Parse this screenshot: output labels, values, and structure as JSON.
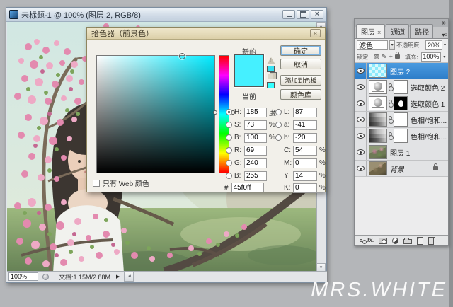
{
  "doc_window": {
    "title": "未标题-1 @ 100% (图层 2, RGB/8)"
  },
  "status_bar": {
    "zoom": "100%",
    "doc_info": "文档:1.15M/2.88M"
  },
  "picker": {
    "title": "拾色器（前景色）",
    "new_label": "新的",
    "current_label": "当前",
    "buttons": {
      "ok": "确定",
      "cancel": "取消",
      "add_to_swatches": "添加到色板",
      "color_libraries": "颜色库"
    },
    "web_only_label": "只有 Web 颜色",
    "hex_label": "#",
    "hex_value": "45f0ff",
    "selected_color_hex": "#45f0ff",
    "hue_degrees": 185,
    "left_fields": [
      {
        "label": "H:",
        "value": "185",
        "unit": "度"
      },
      {
        "label": "S:",
        "value": "73",
        "unit": "%"
      },
      {
        "label": "B:",
        "value": "100",
        "unit": "%"
      },
      {
        "label": "R:",
        "value": "69",
        "unit": ""
      },
      {
        "label": "G:",
        "value": "240",
        "unit": ""
      },
      {
        "label": "B:",
        "value": "255",
        "unit": ""
      }
    ],
    "right_fields": [
      {
        "label": "L:",
        "value": "87",
        "unit": ""
      },
      {
        "label": "a:",
        "value": "-41",
        "unit": ""
      },
      {
        "label": "b:",
        "value": "-20",
        "unit": ""
      },
      {
        "label": "C:",
        "value": "54",
        "unit": "%"
      },
      {
        "label": "M:",
        "value": "0",
        "unit": "%"
      },
      {
        "label": "Y:",
        "value": "14",
        "unit": "%"
      },
      {
        "label": "K:",
        "value": "0",
        "unit": "%"
      }
    ]
  },
  "layers_panel": {
    "tabs": [
      {
        "label": "图层"
      },
      {
        "label": "通道"
      },
      {
        "label": "路径"
      }
    ],
    "active_tab_close": "×",
    "blend_mode": "滤色",
    "opacity_label": "不透明度:",
    "opacity_value": "20%",
    "lock_label": "锁定:",
    "fill_label": "填充:",
    "fill_value": "100%",
    "fx_label": "fx.",
    "layers": [
      {
        "name": "图层 2"
      },
      {
        "name": "选取颜色 2"
      },
      {
        "name": "选取颜色 1"
      },
      {
        "name": "色相/饱和..."
      },
      {
        "name": "色相/饱和..."
      },
      {
        "name": "图层 1"
      },
      {
        "name": "背景"
      }
    ]
  },
  "watermark": "MRS.WHITE",
  "colors": {
    "foreground_cyan": "#45f0ff",
    "selected_layer_blue": "#3f93dc"
  }
}
